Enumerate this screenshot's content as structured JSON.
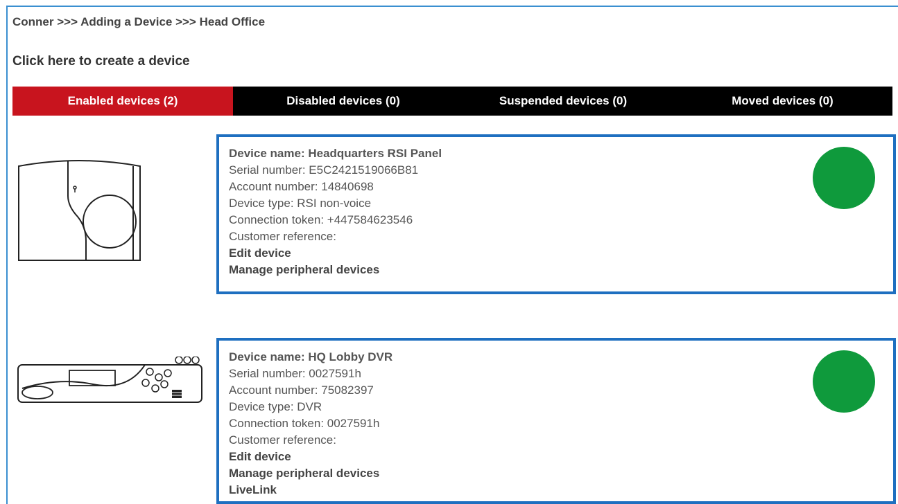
{
  "breadcrumb": "Conner >>> Adding a Device >>> Head Office",
  "create_link": "Click here to create a device",
  "tabs": [
    {
      "label": "Enabled devices (2)",
      "active": true
    },
    {
      "label": "Disabled devices (0)",
      "active": false
    },
    {
      "label": "Suspended devices (0)",
      "active": false
    },
    {
      "label": "Moved devices (0)",
      "active": false
    }
  ],
  "colors": {
    "active_tab": "#c8141e",
    "tab_bar": "#000000",
    "card_border": "#1e6fc0",
    "status_ok": "#0f9a3c"
  },
  "devices": [
    {
      "icon": "rsi-panel-icon",
      "name": "Device name: Headquarters RSI Panel",
      "serial": "Serial number: E5C2421519066B81",
      "account": "Account number: 14840698",
      "type": "Device type: RSI non-voice",
      "token": "Connection token: +447584623546",
      "customer_ref": "Customer reference:",
      "edit": "Edit device",
      "manage": "Manage peripheral devices",
      "status": "online"
    },
    {
      "icon": "dvr-icon",
      "name": "Device name: HQ Lobby DVR",
      "serial": "Serial number: 0027591h",
      "account": "Account number: 75082397",
      "type": "Device type: DVR",
      "token": "Connection token: 0027591h",
      "customer_ref": "Customer reference:",
      "edit": "Edit device",
      "manage": "Manage peripheral devices",
      "livelink": "LiveLink",
      "status": "online"
    }
  ]
}
